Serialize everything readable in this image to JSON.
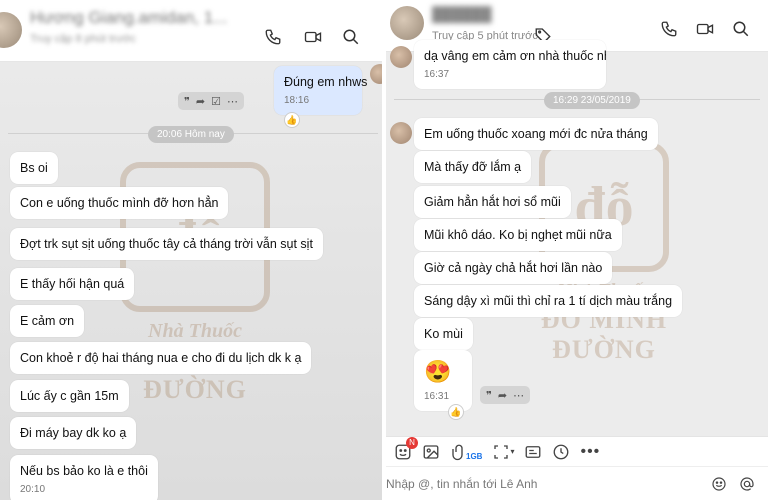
{
  "left": {
    "header": {
      "name": "Hương Giang.amidan, 1...",
      "subtitle": "Truy cập 8 phút trước"
    },
    "my_message": {
      "text": "Đúng em nhws",
      "time": "18:16"
    },
    "date_separator": "20:06 Hôm nay",
    "messages": [
      "Bs oi",
      "Con e uống thuốc mình đỡ hơn hẳn",
      "Đợt trk sụt sịt uống thuốc tây cả tháng trời vẫn sụt sịt",
      "E thấy hối hận quá",
      "E cảm ơn",
      "Con khoẻ r độ hai tháng nua e cho đi du lịch dk k ạ",
      "Lúc ấy c gần 15m",
      "Đi máy bay dk ko ạ",
      "Nếu bs bảo ko là e thôi"
    ],
    "last_time": "20:10"
  },
  "right": {
    "header": {
      "subtitle": "Truy cập 5 phút trước"
    },
    "top_fragment": {
      "text": "dạ vâng em cảm ơn nhà thuốc nhiều ạ",
      "time": "16:37"
    },
    "date_separator": "16:29 23/05/2019",
    "messages": [
      "Em uống thuốc xoang mới đc nửa tháng",
      "Mà thấy đỡ lắm ạ",
      "Giảm hẳn hắt hơi sổ mũi",
      "Mũi khô dáo. Ko bị nghẹt mũi nữa",
      "Giờ cả ngày chả hắt hơi lần nào",
      "Sáng dậy xì mũi thì chỉ ra 1 tí dịch màu trắng",
      "Ko mùi"
    ],
    "emoji": "😍",
    "emoji_time": "16:31",
    "toolbar": {
      "badge": "N",
      "file_size": "1GB"
    },
    "composer": {
      "placeholder": "Nhập @, tin nhắn tới Lê Anh"
    }
  },
  "watermark": {
    "logo_text": "đỗ\nminh",
    "line1": "Nhà Thuốc",
    "line2": "ĐỖ MINH ĐƯỜNG"
  },
  "colors": {
    "my_bubble": "#dbe8ff",
    "chat_bg": "#e8e8e8",
    "badge": "#e53935"
  }
}
